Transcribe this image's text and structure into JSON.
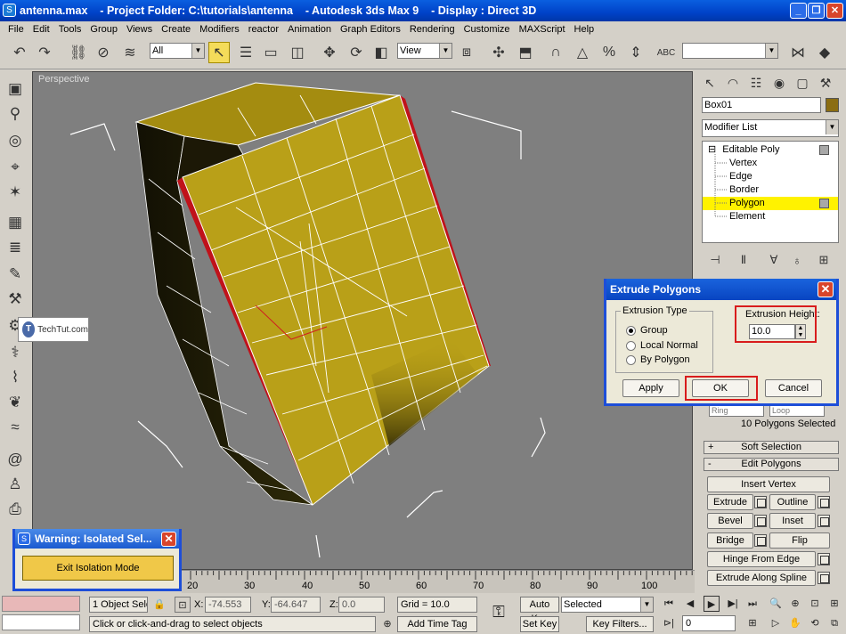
{
  "window": {
    "title": "antenna.max    - Project Folder: C:\\tutorials\\antenna    - Autodesk 3ds Max 9    - Display : Direct 3D",
    "minimize": "_",
    "restore": "❐",
    "close": "✕"
  },
  "menu": [
    "File",
    "Edit",
    "Tools",
    "Group",
    "Views",
    "Create",
    "Modifiers",
    "reactor",
    "Animation",
    "Graph Editors",
    "Rendering",
    "Customize",
    "MAXScript",
    "Help"
  ],
  "toolbar": {
    "selection_filter": "All",
    "ref_coord": "View",
    "named_selection": ""
  },
  "viewport": {
    "label": "Perspective"
  },
  "watermark": {
    "logo": "T",
    "text": "TechTut.com"
  },
  "command_panel": {
    "object_name": "Box01",
    "object_color": "#8b6d12",
    "modifier_list": "Modifier List",
    "stack": {
      "modifier": "Editable Poly",
      "expand": "⊟",
      "subobjects": [
        "Vertex",
        "Edge",
        "Border",
        "Polygon",
        "Element"
      ],
      "selected": "Polygon"
    },
    "ring_label": "Ring",
    "loop_label": "Loop",
    "selected_info": "10 Polygons Selected",
    "soft_selection": {
      "sign": "+",
      "label": "Soft Selection"
    },
    "edit_polygons": {
      "sign": "-",
      "label": "Edit Polygons"
    },
    "buttons": {
      "insert_vertex": "Insert Vertex",
      "extrude": "Extrude",
      "outline": "Outline",
      "bevel": "Bevel",
      "inset": "Inset",
      "bridge": "Bridge",
      "flip": "Flip",
      "hinge": "Hinge From Edge",
      "extrude_spline": "Extrude Along Spline"
    }
  },
  "dialog": {
    "title": "Extrude Polygons",
    "close": "✕",
    "extrusion_type_label": "Extrusion Type",
    "options": [
      "Group",
      "Local Normal",
      "By Polygon"
    ],
    "selected_option": "Group",
    "extrusion_height_label": "Extrusion Height:",
    "extrusion_height": "10.0",
    "apply": "Apply",
    "ok": "OK",
    "cancel": "Cancel"
  },
  "warning": {
    "title": "Warning: Isolated Sel...",
    "close": "✕",
    "exit_button": "Exit Isolation Mode"
  },
  "timeline": {
    "ticks": [
      "20",
      "30",
      "40",
      "50",
      "60",
      "70",
      "80",
      "90",
      "100"
    ]
  },
  "status": {
    "selection": "1 Object Sele",
    "prompt": "Click or click-and-drag to select objects",
    "x_label": "X:",
    "x_value": "-74.553",
    "y_label": "Y:",
    "y_value": "-64.647",
    "z_label": "Z:",
    "z_value": "0.0",
    "grid": "Grid = 10.0",
    "add_time_tag": "Add Time Tag",
    "auto_key": "Auto Key",
    "auto_key_mode": "Selected",
    "set_key": "Set Key",
    "key_filters": "Key Filters...",
    "frame": "0"
  }
}
